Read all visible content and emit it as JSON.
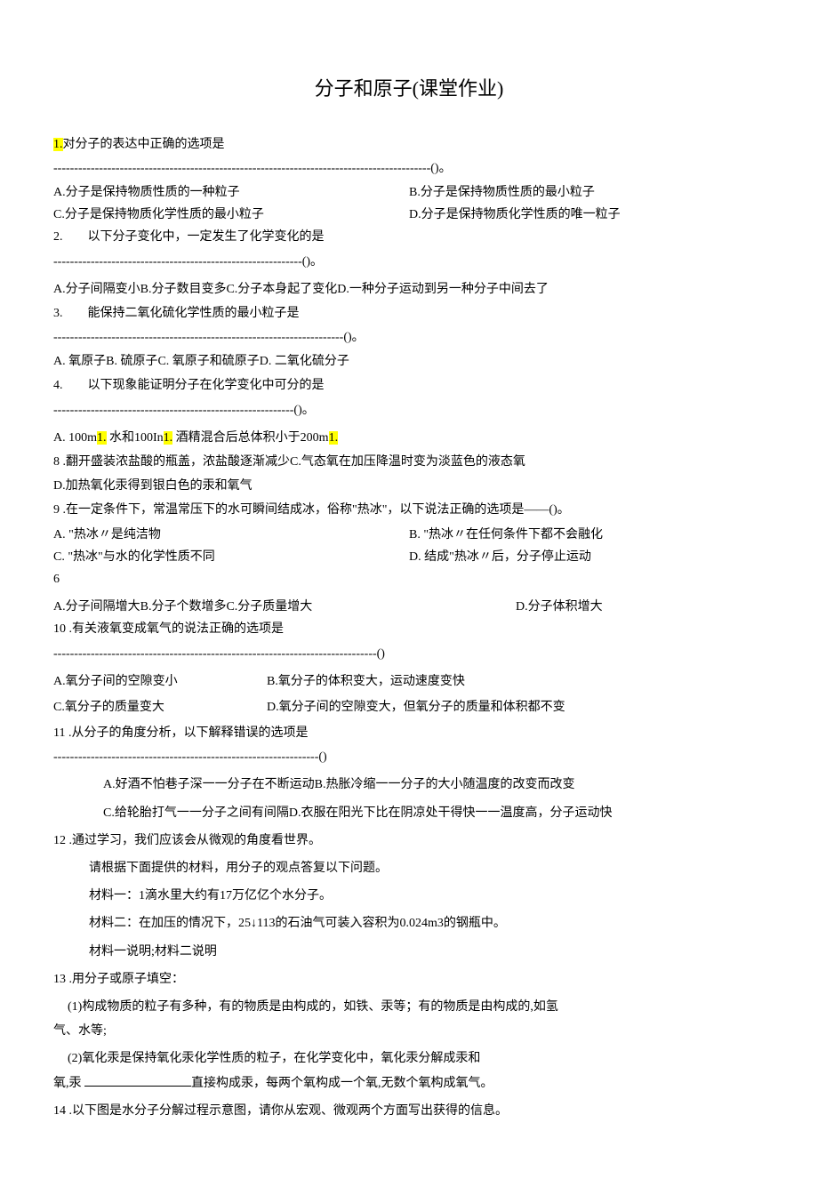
{
  "title": "分子和原子(课堂作业)",
  "q1": {
    "marker": "1.",
    "text": "对分子的表达中正确的选项是",
    "dashes": "-------------------------------------------------------------------------------------------()。",
    "optA": "A.分子是保持物质性质的一种粒子",
    "optB": "B.分子是保持物质性质的最小粒子",
    "optC": "C.分子是保持物质化学性质的最小粒子",
    "optD": "D.分子是保持物质化学性质的唯一粒子"
  },
  "q2": {
    "marker": "2.",
    "text": "以下分子变化中，一定发生了化学变化的是",
    "dashes": "------------------------------------------------------------()。",
    "optLine": "A.分子间隔变小B.分子数目变多C.分子本身起了变化D.一种分子运动到另一种分子中间去了"
  },
  "q3": {
    "marker": "3.",
    "text": "能保持二氧化硫化学性质的最小粒子是",
    "dashes": "----------------------------------------------------------------------()。",
    "optLine": "A. 氧原子B. 硫原子C. 氧原子和硫原子D. 二氧化硫分子"
  },
  "q4": {
    "marker": "4.",
    "text": "以下现象能证明分子在化学变化中可分的是",
    "dashes": "----------------------------------------------------------()。"
  },
  "q4opts": {
    "labelA": "A. 100m",
    "hl1": "1.",
    "mid1": " 水和100In",
    "hl2": "1.",
    "mid2": " 酒精混合后总体积小于200m",
    "hl3": "1."
  },
  "q8": {
    "marker": "8",
    "text": " .翻开盛装浓盐酸的瓶盖，浓盐酸逐渐减少C.气态氧在加压降温时变为淡蓝色的液态氧",
    "optD": "D.加热氧化汞得到银白色的汞和氧气"
  },
  "q9": {
    "marker": "9",
    "text": " .在一定条件下，常温常压下的水可瞬间结成冰，俗称\"热冰\"，以下说法正确的选项是——()。",
    "optA": "A. \"热冰〃是纯洁物",
    "optB": "B. \"热冰〃在任何条件下都不会融化",
    "optC": "C. \"热冰\"与水的化学性质不同",
    "optD": "D. 结成\"热冰〃后，分子停止运动"
  },
  "q6": {
    "marker": "6",
    "optA": "A.分子间隔增大B.分子个数增多C.分子质量增大",
    "optD": "D.分子体积增大"
  },
  "q10": {
    "marker": "10",
    "text": " .有关液氧变成氧气的说法正确的选项是",
    "dashes": "------------------------------------------------------------------------------()",
    "optA": "A.氧分子间的空隙变小",
    "optB": "B.氧分子的体积变大，运动速度变快",
    "optC": "C.氧分子的质量变大",
    "optD": "D.氧分子间的空隙变大，但氧分子的质量和体积都不变"
  },
  "q11": {
    "marker": "11",
    "text": " .从分子的角度分析，以下解释错误的选项是",
    "dashes": "----------------------------------------------------------------()",
    "optAB": "A.好酒不怕巷子深一一分子在不断运动B.热胀冷缩一一分子的大小随温度的改变而改变",
    "optCD": "C.给轮胎打气一一分子之间有间隔D.衣服在阳光下比在阴凉处干得快一一温度高，分子运动快"
  },
  "q12": {
    "marker": "12",
    "text": " .通过学习，我们应该会从微观的角度看世界。",
    "line1": "请根据下面提供的材料，用分子的观点答复以下问题。",
    "line2": "材料一：1滴水里大约有17万亿亿个水分子。",
    "line3": "材料二：在加压的情况下，25↓113的石油气可装入容积为0.024m3的钢瓶中。",
    "line4": "材料一说明;材料二说明"
  },
  "q13": {
    "marker": "13",
    "text": " .用分子或原子填空：",
    "line1": "(1)构成物质的粒子有多种，有的物质是由构成的，如铁、汞等；有的物质是由构成的,如氢",
    "line1b": "气、水等;",
    "line2a": "(2)氧化汞是保持氧化汞化学性质的粒子，在化学变化中，氧化汞分解成汞和",
    "line2b": "氧,汞",
    "line2c": "直接构成汞，每两个氧构成一个氧,无数个氧构成氧气。"
  },
  "q14": {
    "marker": "14",
    "text": " .以下图是水分子分解过程示意图，请你从宏观、微观两个方面写出获得的信息。"
  }
}
